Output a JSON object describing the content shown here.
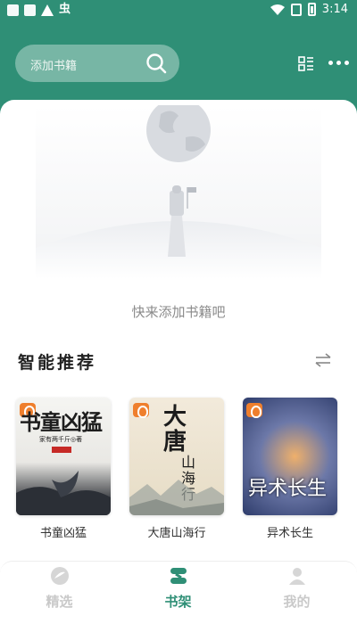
{
  "status_bar": {
    "time": "3:14",
    "glyph": "虫"
  },
  "header": {
    "search_placeholder": "添加书籍",
    "icons": [
      "search-icon",
      "grid-list-icon",
      "more-icon"
    ]
  },
  "empty_state": {
    "message": "快来添加书籍吧"
  },
  "recommend": {
    "title": "智能推荐",
    "books": [
      {
        "title": "书童凶猛",
        "cover_title": "书童凶猛",
        "cover_author": "家有两千斤◎著"
      },
      {
        "title": "大唐山海行",
        "cover_title": "大唐",
        "cover_subtitle": "山海行"
      },
      {
        "title": "异术长生",
        "cover_title": "异术长生"
      }
    ]
  },
  "nav": {
    "items": [
      {
        "label": "精选",
        "icon": "discover-icon",
        "active": false
      },
      {
        "label": "书架",
        "icon": "bookshelf-icon",
        "active": true
      },
      {
        "label": "我的",
        "icon": "profile-icon",
        "active": false
      }
    ]
  },
  "colors": {
    "brand": "#2f8f76",
    "background": "#ffffff",
    "muted_text": "#8a8a8a"
  }
}
